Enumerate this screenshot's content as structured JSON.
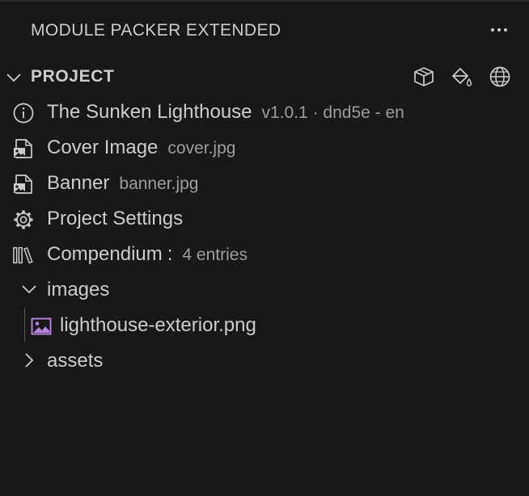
{
  "panel": {
    "title": "MODULE PACKER EXTENDED",
    "more_icon": "ellipsis-icon"
  },
  "section": {
    "title": "PROJECT",
    "actions": [
      {
        "name": "package-icon"
      },
      {
        "name": "paint-bucket-icon"
      },
      {
        "name": "globe-icon"
      }
    ]
  },
  "tree": {
    "project": {
      "label": "The Sunken Lighthouse",
      "description": "v1.0.1 · dnd5e - en",
      "icon": "info-icon"
    },
    "cover": {
      "label": "Cover Image",
      "description": "cover.jpg",
      "icon": "file-image-icon"
    },
    "banner": {
      "label": "Banner",
      "description": "banner.jpg",
      "icon": "file-image-icon"
    },
    "settings": {
      "label": "Project Settings",
      "icon": "gear-icon"
    },
    "compendium": {
      "label": "Compendium",
      "separator": ":",
      "description": "4 entries",
      "icon": "library-icon"
    },
    "images_folder": {
      "label": "images",
      "expanded": true
    },
    "image_file": {
      "label": "lighthouse-exterior.png",
      "icon": "image-icon"
    },
    "assets_folder": {
      "label": "assets",
      "expanded": false
    }
  },
  "colors": {
    "background": "#181818",
    "text": "#cccccc",
    "description": "#9d9d9d",
    "image_icon": "#b180d7"
  }
}
